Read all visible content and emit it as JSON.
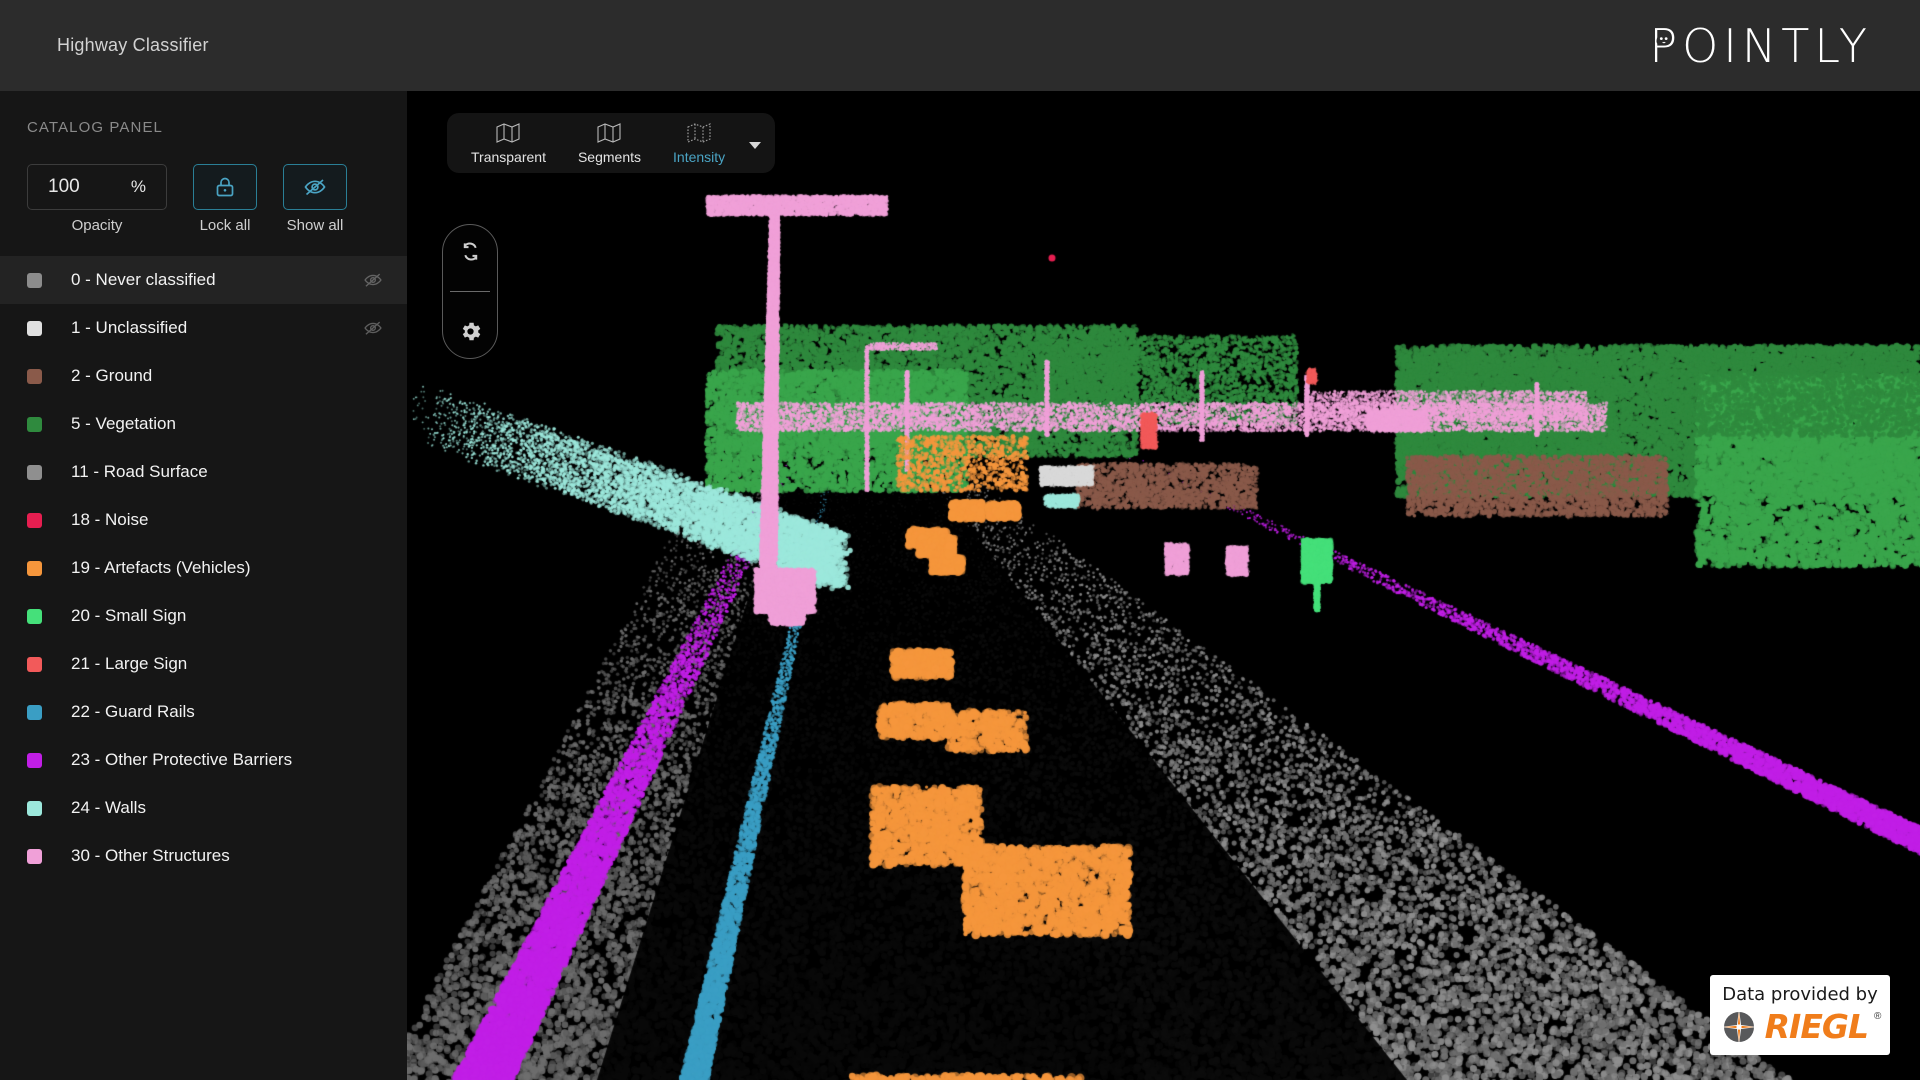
{
  "header": {
    "title": "Highway Classifier",
    "brand": "POINTLY",
    "brand_mark_icon": "pointly-dog-icon"
  },
  "sidebar": {
    "panel_label": "CATALOG PANEL",
    "opacity": {
      "value": "100",
      "unit": "%",
      "caption": "Opacity",
      "placeholder": "100"
    },
    "lock_all": {
      "caption": "Lock all",
      "icon": "lock-icon"
    },
    "show_all": {
      "caption": "Show all",
      "icon": "eye-off-icon"
    },
    "accent_color": "#2a7f96",
    "classes": [
      {
        "label": "0 - Never classified",
        "color": "#8c8c8c",
        "hidden": true,
        "active": true
      },
      {
        "label": "1 - Unclassified",
        "color": "#e0e0e0",
        "hidden": true,
        "active": false
      },
      {
        "label": "2 - Ground",
        "color": "#8a5a4a",
        "hidden": false,
        "active": false
      },
      {
        "label": "5 - Vegetation",
        "color": "#2f8a3e",
        "hidden": false,
        "active": false
      },
      {
        "label": "11 - Road Surface",
        "color": "#8f8f8f",
        "hidden": false,
        "active": false
      },
      {
        "label": "18 - Noise",
        "color": "#e61e50",
        "hidden": false,
        "active": false
      },
      {
        "label": "19 - Artefacts (Vehicles)",
        "color": "#f5963c",
        "hidden": false,
        "active": false
      },
      {
        "label": "20 - Small Sign",
        "color": "#45e07a",
        "hidden": false,
        "active": false
      },
      {
        "label": "21 - Large Sign",
        "color": "#f25a5a",
        "hidden": false,
        "active": false
      },
      {
        "label": "22 - Guard Rails",
        "color": "#3a9ec4",
        "hidden": false,
        "active": false
      },
      {
        "label": "23 - Other Protective Barriers",
        "color": "#c11ee6",
        "hidden": false,
        "active": false
      },
      {
        "label": "24 - Walls",
        "color": "#9ce8dc",
        "hidden": false,
        "active": false
      },
      {
        "label": "30 - Other Structures",
        "color": "#f0a0d8",
        "hidden": false,
        "active": false
      }
    ]
  },
  "viewport": {
    "mode_bar": {
      "items": [
        {
          "label": "Transparent",
          "icon": "map-outline-icon",
          "active": false
        },
        {
          "label": "Segments",
          "icon": "map-outline-icon",
          "active": false
        },
        {
          "label": "Intensity",
          "icon": "map-dotted-icon",
          "active": true
        }
      ],
      "caret_icon": "chevron-down-icon"
    },
    "tool_pill": {
      "items": [
        {
          "icon": "sync-icon"
        },
        {
          "icon": "gear-icon"
        }
      ]
    },
    "attribution": {
      "line1": "Data provided by",
      "line2": "RIEGL",
      "registered": "®",
      "logo_icon": "riegl-target-icon",
      "brand_color": "#f07d1b"
    }
  }
}
